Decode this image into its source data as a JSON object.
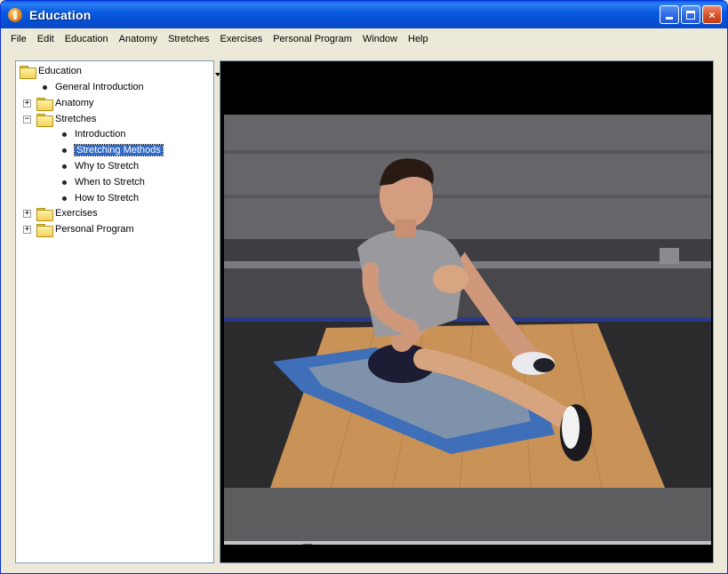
{
  "window": {
    "title": "Education",
    "buttons": {
      "minimize": "minimize",
      "maximize": "maximize",
      "close": "×"
    }
  },
  "menubar": [
    "File",
    "Edit",
    "Education",
    "Anatomy",
    "Stretches",
    "Exercises",
    "Personal Program",
    "Window",
    "Help"
  ],
  "tree": {
    "root": "Education",
    "items": [
      {
        "label": "General Introduction",
        "type": "leaf",
        "level": 1
      },
      {
        "label": "Anatomy",
        "type": "folder",
        "expander": "+",
        "level": 1
      },
      {
        "label": "Stretches",
        "type": "folder",
        "expander": "−",
        "level": 1
      },
      {
        "label": "Introduction",
        "type": "leaf",
        "level": 2
      },
      {
        "label": "Stretching Methods",
        "type": "leaf",
        "level": 2,
        "selected": true
      },
      {
        "label": "Why to Stretch",
        "type": "leaf",
        "level": 2
      },
      {
        "label": "When to Stretch",
        "type": "leaf",
        "level": 2
      },
      {
        "label": "How to Stretch",
        "type": "leaf",
        "level": 2
      },
      {
        "label": "Exercises",
        "type": "folder",
        "expander": "+",
        "level": 1
      },
      {
        "label": "Personal Program",
        "type": "folder",
        "expander": "+",
        "level": 1
      }
    ]
  },
  "player": {
    "icons": [
      "play-icon",
      "step-back-icon",
      "step-forward-icon",
      "volume-icon",
      "fullscreen-icon"
    ],
    "seek_position_fraction": 0.05
  },
  "colors": {
    "selection": "#316ac5",
    "titlebar": "#0a5be0",
    "video_background": "#000000"
  }
}
